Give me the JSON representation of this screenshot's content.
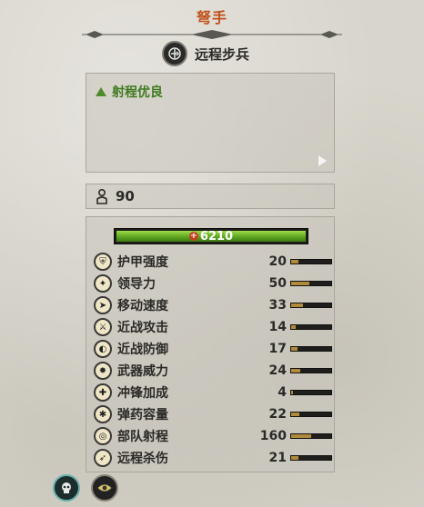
{
  "unit": {
    "title": "弩手",
    "class_label": "远程步兵",
    "trait": "射程优良",
    "unit_size": "90",
    "hit_points": "6210"
  },
  "stats": [
    {
      "name": "护甲强度",
      "value": "20",
      "icon": "armor-icon",
      "level": 0.18
    },
    {
      "name": "领导力",
      "value": "50",
      "icon": "leadership-icon",
      "level": 0.45
    },
    {
      "name": "移动速度",
      "value": "33",
      "icon": "speed-icon",
      "level": 0.3
    },
    {
      "name": "近战攻击",
      "value": "14",
      "icon": "melee-attack-icon",
      "level": 0.12
    },
    {
      "name": "近战防御",
      "value": "17",
      "icon": "melee-defense-icon",
      "level": 0.15
    },
    {
      "name": "武器威力",
      "value": "24",
      "icon": "weapon-strength-icon",
      "level": 0.22
    },
    {
      "name": "冲锋加成",
      "value": "4",
      "icon": "charge-bonus-icon",
      "level": 0.04
    },
    {
      "name": "弹药容量",
      "value": "22",
      "icon": "ammunition-icon",
      "level": 0.2
    },
    {
      "name": "部队射程",
      "value": "160",
      "icon": "range-icon",
      "level": 0.5
    },
    {
      "name": "远程杀伤",
      "value": "21",
      "icon": "missile-damage-icon",
      "level": 0.19
    }
  ],
  "colors": {
    "title": "#c0521b",
    "trait_positive": "#3f7a20",
    "hp_bar": "#5ea620",
    "stat_bar": "#b08b3c"
  }
}
